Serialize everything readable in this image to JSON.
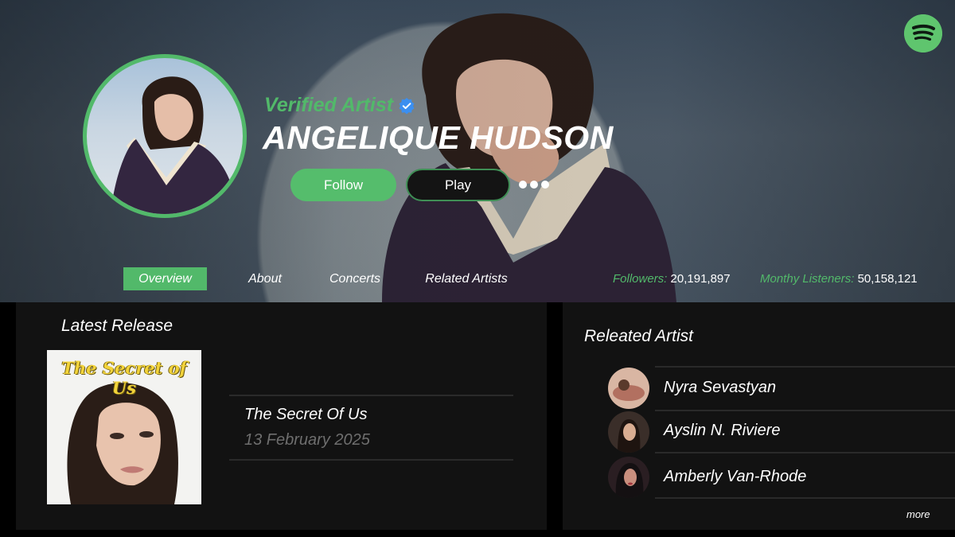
{
  "header": {
    "verified_label": "Verified Artist",
    "artist_name": "ANGELIQUE HUDSON",
    "follow_label": "Follow",
    "play_label": "Play",
    "more_icon": "more-horizontal-icon",
    "logo_icon": "spotify-icon",
    "verified_icon": "verified-badge-icon"
  },
  "tabs": [
    {
      "label": "Overview",
      "active": true
    },
    {
      "label": "About",
      "active": false
    },
    {
      "label": "Concerts",
      "active": false
    },
    {
      "label": "Related Artists",
      "active": false
    }
  ],
  "stats": {
    "followers_label": "Followers:",
    "followers_value": "20,191,897",
    "listeners_label": "Monthy Listeners:",
    "listeners_value": "50,158,121"
  },
  "latest_release": {
    "section_title": "Latest Release",
    "cover_text": "The Secret of Us",
    "title": "The Secret Of Us",
    "date": "13 February 2025"
  },
  "related": {
    "section_title": "Releated Artist",
    "artists": [
      {
        "name": "Nyra Sevastyan"
      },
      {
        "name": "Ayslin N. Riviere"
      },
      {
        "name": "Amberly Van-Rhode"
      }
    ],
    "more_label": "more"
  },
  "colors": {
    "accent": "#52b96a",
    "panel": "#121212",
    "background": "#000000",
    "muted_text": "#6e6e6e",
    "verified_blue": "#3b8ff0"
  }
}
